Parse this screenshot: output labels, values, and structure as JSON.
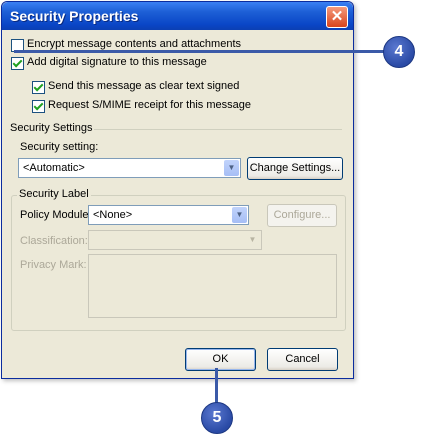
{
  "dialog": {
    "title": "Security Properties",
    "close_glyph": "✕"
  },
  "options": {
    "encrypt_label": "Encrypt message contents and attachments",
    "encrypt_checked": false,
    "sign_label": "Add digital signature to this message",
    "sign_checked": true,
    "clear_text_label": "Send this message as clear text signed",
    "clear_text_checked": true,
    "receipt_label": "Request S/MIME receipt for this message",
    "receipt_checked": true
  },
  "security_settings": {
    "section_label": "Security Settings",
    "setting_label": "Security setting:",
    "setting_value": "<Automatic>",
    "change_button": "Change Settings..."
  },
  "security_label": {
    "group_title": "Security Label",
    "policy_label": "Policy Module:",
    "policy_value": "<None>",
    "configure_button": "Configure...",
    "classification_label": "Classification:",
    "classification_value": "",
    "privacy_label": "Privacy Mark:",
    "privacy_value": ""
  },
  "buttons": {
    "ok": "OK",
    "cancel": "Cancel"
  },
  "callouts": {
    "sign": "4",
    "ok": "5"
  }
}
